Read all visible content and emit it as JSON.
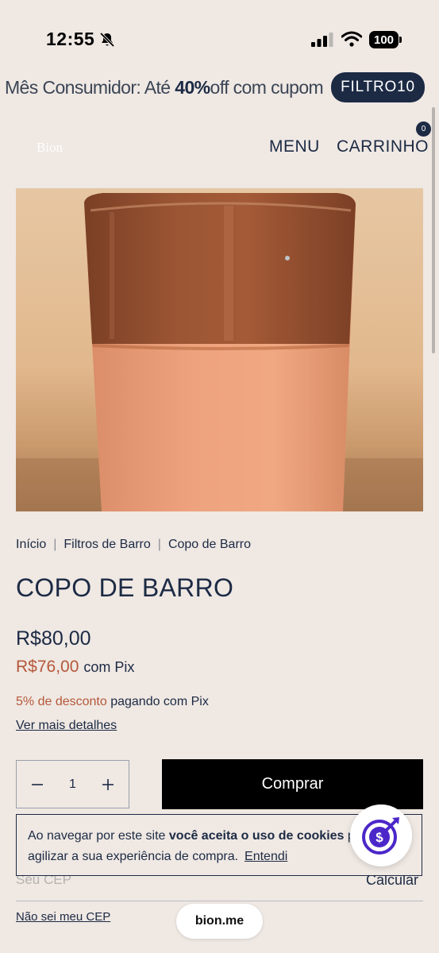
{
  "status_bar": {
    "time": "12:55",
    "battery": "100"
  },
  "promo": {
    "text_before": "Mês Consumidor: Até ",
    "text_bold": "40%",
    "text_after": "off com cupom",
    "code": "FILTRO10"
  },
  "header": {
    "logo": "Bion",
    "menu_label": "MENU",
    "cart_label": "CARRINHO",
    "cart_count": "0"
  },
  "breadcrumb": {
    "items": [
      "Início",
      "Filtros de Barro",
      "Copo de Barro"
    ],
    "separator": "|"
  },
  "product": {
    "title": "COPO DE BARRO",
    "price": "R$80,00",
    "pix_price": "R$76,00",
    "pix_label": "com Pix",
    "discount_highlight": "5% de desconto",
    "discount_rest": " pagando com Pix",
    "details_link": "Ver mais detalhes"
  },
  "purchase": {
    "quantity": "1",
    "buy_label": "Comprar"
  },
  "shipping": {
    "cep_placeholder": "Seu CEP",
    "calc_label": "Calcular",
    "unknown_cep": "Não sei meu CEP"
  },
  "cookie": {
    "text_before": "Ao navegar por este site ",
    "text_bold": "você aceita o uso de cookies",
    "text_mid": " p",
    "text_line2": "agilizar a sua experiência de compra.",
    "accept_label": "Entendi"
  },
  "browser": {
    "url": "bion.me"
  },
  "colors": {
    "background": "#efe8e3",
    "navy": "#1c2a44",
    "accent": "#b5583a",
    "fab_icon": "#4b27c9"
  }
}
